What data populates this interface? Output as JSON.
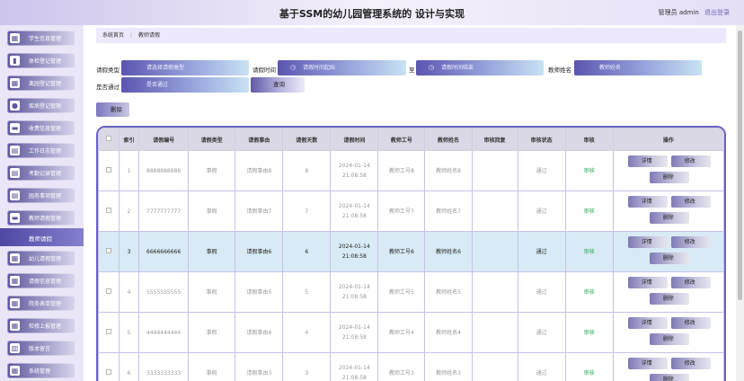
{
  "header": {
    "title": "基于SSM的幼儿园管理系统的 设计与实现",
    "user_label": "管理员 admin",
    "logout": "退出登录"
  },
  "sidebar": {
    "items": [
      {
        "label": "学生信息管理",
        "icon": "grid-icon"
      },
      {
        "label": "体检登记管理",
        "icon": "bar-chart-icon"
      },
      {
        "label": "离园登记管理",
        "icon": "grid-icon"
      },
      {
        "label": "疾病登记管理",
        "icon": "pin-icon"
      },
      {
        "label": "收费信息管理",
        "icon": "card-icon"
      },
      {
        "label": "工作日志管理",
        "icon": "doc-icon"
      },
      {
        "label": "考勤记录管理",
        "icon": "doc-icon"
      },
      {
        "label": "园务事项管理",
        "icon": "doc-icon"
      },
      {
        "label": "教师请假管理",
        "icon": "folder-icon"
      }
    ],
    "active": "教师请假",
    "items2": [
      {
        "label": "幼儿请假管理",
        "icon": "grid-icon"
      },
      {
        "label": "请假信息管理",
        "icon": "grid-icon"
      },
      {
        "label": "院务表单管理",
        "icon": "grid-icon"
      },
      {
        "label": "检修上报管理",
        "icon": "grid-icon"
      },
      {
        "label": "版本留言",
        "icon": "book-icon"
      },
      {
        "label": "系统管理",
        "icon": "grid-icon"
      }
    ]
  },
  "breadcrumb": {
    "home": "系统首页",
    "sep": "⋮",
    "current": "教师请假"
  },
  "filters": {
    "leave_type_label": "请假类型",
    "leave_type_placeholder": "请选择请假类型",
    "leave_time_label": "请假时间",
    "start_placeholder": "请假时间起始",
    "to_label": "至",
    "end_placeholder": "请假时间结束",
    "teacher_name_label": "教师姓名",
    "teacher_name_placeholder": "教师姓名",
    "passed_label": "是否通过",
    "passed_placeholder": "是否通过",
    "query_label": "查询"
  },
  "delete_label": "删除",
  "table": {
    "headers": [
      "索引",
      "请假编号",
      "请假类型",
      "请假事由",
      "请假天数",
      "请假时间",
      "教师工号",
      "教师姓名",
      "审核回复",
      "审核状态",
      "审核",
      "操作"
    ],
    "rows": [
      {
        "idx": "1",
        "no": "8888888888",
        "type": "事假",
        "reason": "请假事由8",
        "days": "8",
        "time": "2024-01-14 21:08:58",
        "tid": "教师工号8",
        "tname": "教师姓名8",
        "reply": "",
        "status": "通过",
        "audit": "审核"
      },
      {
        "idx": "2",
        "no": "7777777777",
        "type": "事假",
        "reason": "请假事由7",
        "days": "7",
        "time": "2024-01-14 21:08:58",
        "tid": "教师工号7",
        "tname": "教师姓名7",
        "reply": "",
        "status": "通过",
        "audit": "审核"
      },
      {
        "idx": "3",
        "no": "6666666666",
        "type": "事假",
        "reason": "请假事由6",
        "days": "6",
        "time": "2024-01-14 21:08:58",
        "tid": "教师工号6",
        "tname": "教师姓名6",
        "reply": "",
        "status": "通过",
        "audit": "审核"
      },
      {
        "idx": "4",
        "no": "5555555555",
        "type": "事假",
        "reason": "请假事由5",
        "days": "5",
        "time": "2024-01-14 21:08:58",
        "tid": "教师工号5",
        "tname": "教师姓名5",
        "reply": "",
        "status": "通过",
        "audit": "审核"
      },
      {
        "idx": "5",
        "no": "4444444444",
        "type": "事假",
        "reason": "请假事由4",
        "days": "4",
        "time": "2024-01-14 21:08:58",
        "tid": "教师工号4",
        "tname": "教师姓名4",
        "reply": "",
        "status": "通过",
        "audit": "审核"
      },
      {
        "idx": "6",
        "no": "3333333333",
        "type": "事假",
        "reason": "请假事由3",
        "days": "3",
        "time": "2024-01-14 21:08:58",
        "tid": "教师工号3",
        "tname": "教师姓名3",
        "reply": "",
        "status": "通过",
        "audit": "审核"
      }
    ],
    "ops": {
      "detail": "详情",
      "edit": "修改",
      "delete": "删除"
    }
  },
  "colors": {
    "accent": "#6a62c4",
    "audit_green": "#2eaa5a",
    "highlight_row": "#d8eaf5"
  }
}
